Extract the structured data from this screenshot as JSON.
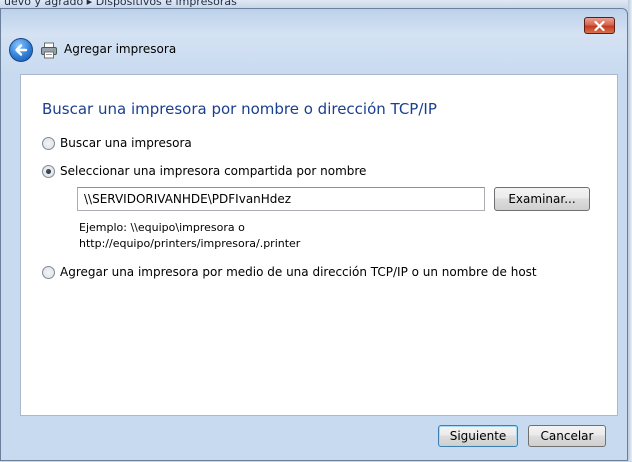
{
  "background": {
    "breadcrumb_text": "uevo y agrado  ▸  Dispositivos e impresoras"
  },
  "window": {
    "title": "Agregar impresora",
    "back_icon": "back-arrow-icon",
    "printer_icon": "printer-icon",
    "close_icon": "close-icon"
  },
  "main": {
    "instruction": "Buscar una impresora por nombre o dirección TCP/IP",
    "options": [
      {
        "label": "Buscar una impresora",
        "selected": false
      },
      {
        "label": "Seleccionar una impresora compartida por nombre",
        "selected": true
      },
      {
        "label": "Agregar una impresora por medio de una dirección TCP/IP o un nombre de host",
        "selected": false
      }
    ],
    "shared_printer_path": "\\\\SERVIDORIVANHDE\\PDFIvanHdez",
    "browse_label": "Examinar...",
    "example_line1": "Ejemplo: \\\\equipo\\impresora o",
    "example_line2": "http://equipo/printers/impresora/.printer"
  },
  "footer": {
    "next_label": "Siguiente",
    "cancel_label": "Cancelar"
  },
  "colors": {
    "instruction_text": "#1a3f8f",
    "window_frame": "#c8daf0",
    "close_button": "#c23c22",
    "default_button_border": "#3c7fb1"
  }
}
